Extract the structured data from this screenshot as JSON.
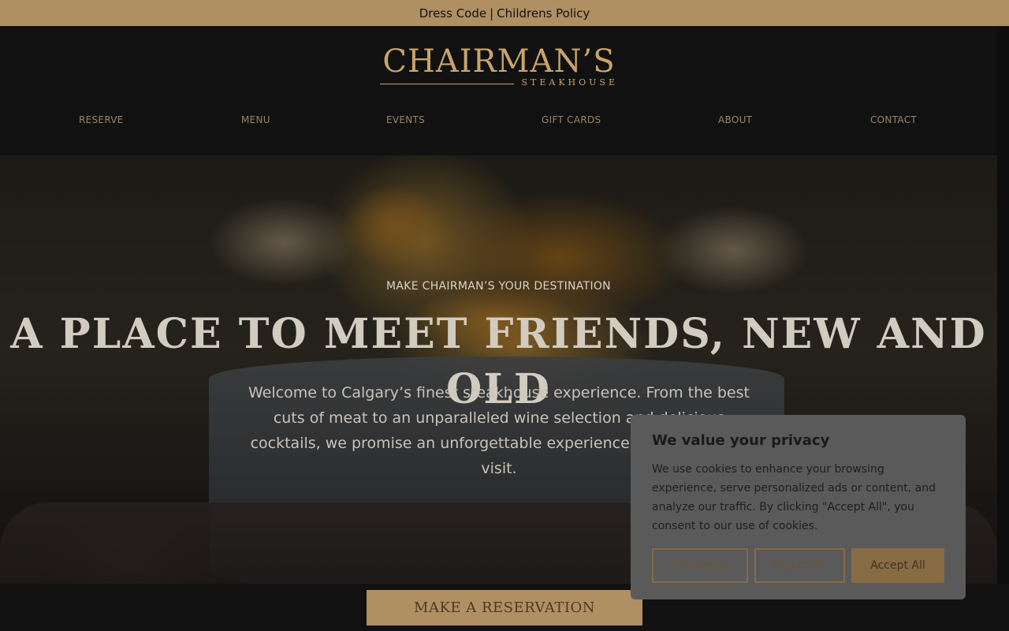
{
  "topbar": {
    "dress_code": "Dress Code",
    "separator": "|",
    "childrens_policy": "Childrens Policy"
  },
  "logo": {
    "name": "CHAIRMAN’S",
    "subtitle": "STEAKHOUSE"
  },
  "nav": {
    "items": [
      {
        "label": "RESERVE"
      },
      {
        "label": "MENU"
      },
      {
        "label": "EVENTS"
      },
      {
        "label": "GIFT CARDS"
      },
      {
        "label": "ABOUT"
      },
      {
        "label": "CONTACT"
      }
    ]
  },
  "hero": {
    "kicker": "MAKE CHAIRMAN’S YOUR DESTINATION",
    "title": "A PLACE TO MEET FRIENDS, NEW AND OLD",
    "text": "Welcome to Calgary’s finest steakhouse experience. From the best cuts of meat to an unparalleled wine selection and delicious cocktails, we promise an unforgettable experience every time you visit."
  },
  "reservation": {
    "button_label": "MAKE A RESERVATION"
  },
  "cookie_dialog": {
    "title": "We value your privacy",
    "body": "We use cookies to enhance your browsing experience, serve personalized ads or content, and analyze our traffic. By clicking \"Accept All\", you consent to our use of cookies.",
    "customize_label": "Customize",
    "reject_label": "Reject All",
    "accept_label": "Accept All"
  },
  "colors": {
    "gold": "#b08f63",
    "header_bg": "#111111",
    "dialog_bg": "#5a5a5a"
  }
}
